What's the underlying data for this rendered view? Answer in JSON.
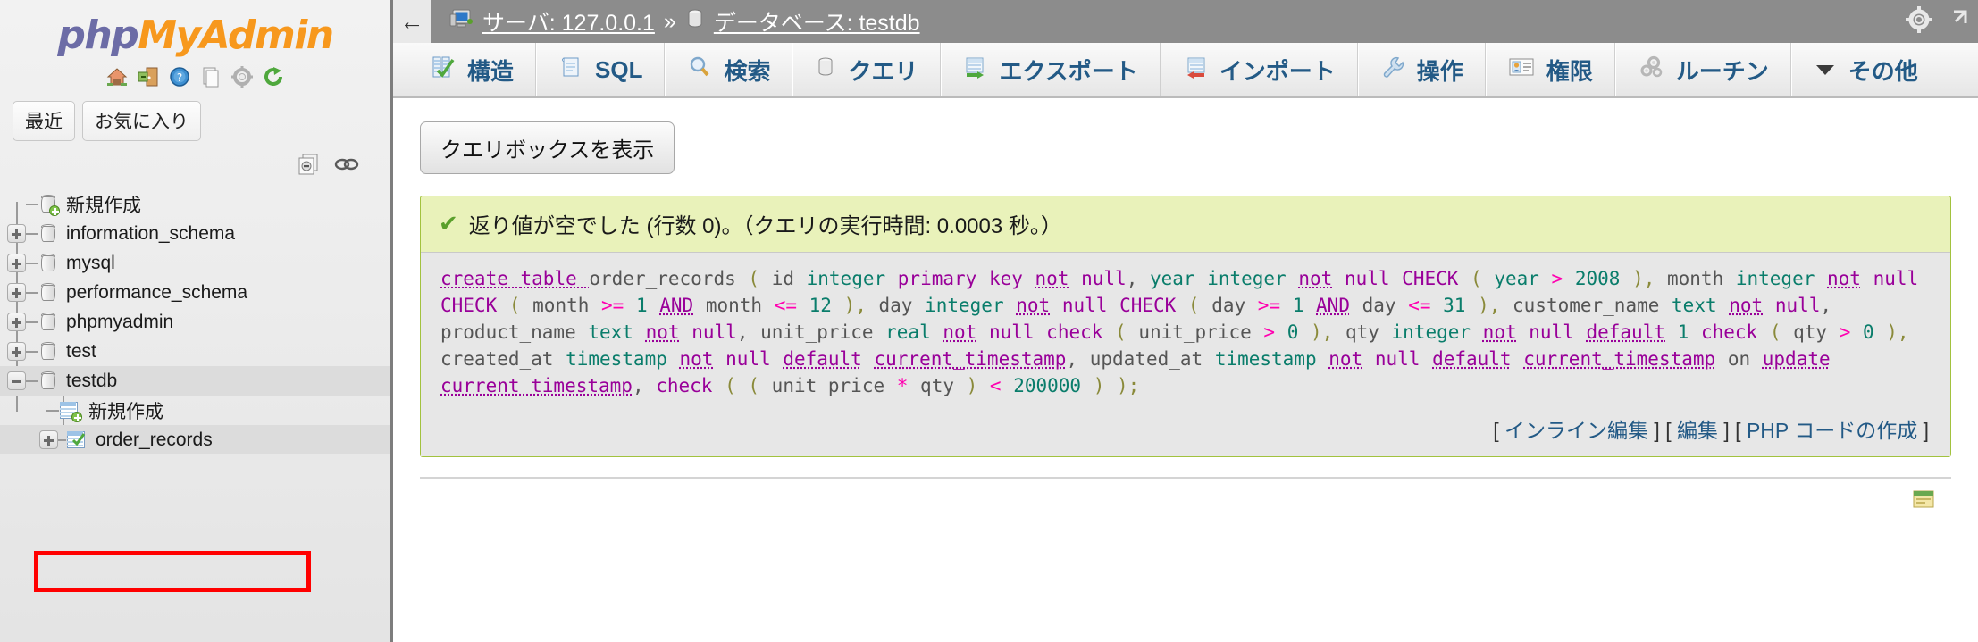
{
  "sidebar": {
    "logo": {
      "part1": "php",
      "part2": "MyAdmin"
    },
    "logo_icons": [
      {
        "name": "home-icon",
        "title": "ホーム"
      },
      {
        "name": "logout-icon",
        "title": "ログアウト"
      },
      {
        "name": "help-icon",
        "title": "ヘルプ"
      },
      {
        "name": "docs-icon",
        "title": "ドキュメント"
      },
      {
        "name": "settings-icon",
        "title": "設定"
      },
      {
        "name": "reload-icon",
        "title": "再読み込み"
      }
    ],
    "quick_tabs": [
      {
        "label": "最近"
      },
      {
        "label": "お気に入り"
      }
    ],
    "tree_controls": [
      {
        "name": "collapse-all-icon"
      },
      {
        "name": "link-with-main-icon"
      }
    ],
    "tree": [
      {
        "label": "新規作成",
        "type": "new-db",
        "expander": "none",
        "selected": false
      },
      {
        "label": "information_schema",
        "type": "db",
        "expander": "plus",
        "selected": false
      },
      {
        "label": "mysql",
        "type": "db",
        "expander": "plus",
        "selected": false
      },
      {
        "label": "performance_schema",
        "type": "db",
        "expander": "plus",
        "selected": false
      },
      {
        "label": "phpmyadmin",
        "type": "db",
        "expander": "plus",
        "selected": false
      },
      {
        "label": "test",
        "type": "db",
        "expander": "plus",
        "selected": false
      },
      {
        "label": "testdb",
        "type": "db",
        "expander": "minus",
        "selected": true
      }
    ],
    "tree_children": [
      {
        "label": "新規作成",
        "type": "new-table",
        "expander": "none"
      },
      {
        "label": "order_records",
        "type": "table",
        "expander": "plus",
        "highlighted": true
      }
    ],
    "highlight_color": "#ff0000"
  },
  "topbar": {
    "back_icon": "←",
    "server_icon": "server-icon",
    "server_label": "サーバ: 127.0.0.1",
    "separator": "»",
    "db_icon": "database-icon",
    "db_label": "データベース: testdb",
    "right_icons": [
      {
        "name": "settings-gear-icon"
      },
      {
        "name": "external-link-icon"
      }
    ]
  },
  "tabs": [
    {
      "label": "構造",
      "icon": "structure-icon",
      "active": false
    },
    {
      "label": "SQL",
      "icon": "sql-icon",
      "active": false
    },
    {
      "label": "検索",
      "icon": "search-icon",
      "active": false
    },
    {
      "label": "クエリ",
      "icon": "query-icon",
      "active": false
    },
    {
      "label": "エクスポート",
      "icon": "export-icon",
      "active": false
    },
    {
      "label": "インポート",
      "icon": "import-icon",
      "active": false
    },
    {
      "label": "操作",
      "icon": "operations-wrench-icon",
      "active": false
    },
    {
      "label": "権限",
      "icon": "privileges-icon",
      "active": false
    },
    {
      "label": "ルーチン",
      "icon": "routines-gears-icon",
      "active": false
    },
    {
      "label": "その他",
      "icon": "chevron-down-icon",
      "active": false
    }
  ],
  "content": {
    "show_query_button": "クエリボックスを表示",
    "result_message": "返り値が空でした (行数 0)。（クエリの実行時間: 0.0003 秒。）",
    "sql_lines": [
      [
        {
          "t": "create ",
          "c": "kwu"
        },
        {
          "t": "table ",
          "c": "kwu"
        },
        {
          "t": "order_records ",
          "c": "idn"
        },
        {
          "t": "( ",
          "c": "pn"
        },
        {
          "t": "id ",
          "c": "idn"
        },
        {
          "t": "integer ",
          "c": "typ"
        },
        {
          "t": "primary ",
          "c": "kw"
        },
        {
          "t": "key ",
          "c": "kw"
        },
        {
          "t": "not",
          "c": "kwu"
        },
        {
          "t": " ",
          "c": "idn"
        },
        {
          "t": "null",
          "c": "kw"
        },
        {
          "t": ", ",
          "c": "idn"
        },
        {
          "t": "year ",
          "c": "typ"
        },
        {
          "t": "integer ",
          "c": "typ"
        },
        {
          "t": "not",
          "c": "kwu"
        },
        {
          "t": " ",
          "c": "idn"
        },
        {
          "t": "null ",
          "c": "kw"
        },
        {
          "t": "CHECK ",
          "c": "kw"
        },
        {
          "t": "( ",
          "c": "pn"
        },
        {
          "t": "year ",
          "c": "typ"
        },
        {
          "t": "> ",
          "c": "op"
        },
        {
          "t": "2008 ",
          "c": "num"
        },
        {
          "t": "), ",
          "c": "pn"
        },
        {
          "t": "month ",
          "c": "idn"
        },
        {
          "t": "integer ",
          "c": "typ"
        },
        {
          "t": "not",
          "c": "kwu"
        },
        {
          "t": " ",
          "c": "idn"
        },
        {
          "t": "null",
          "c": "kw"
        }
      ],
      [
        {
          "t": "CHECK ",
          "c": "kw"
        },
        {
          "t": "( ",
          "c": "pn"
        },
        {
          "t": "month ",
          "c": "idn"
        },
        {
          "t": ">= ",
          "c": "op"
        },
        {
          "t": "1 ",
          "c": "num"
        },
        {
          "t": "AND",
          "c": "kwu"
        },
        {
          "t": " ",
          "c": "idn"
        },
        {
          "t": "month ",
          "c": "idn"
        },
        {
          "t": "<= ",
          "c": "op"
        },
        {
          "t": "12 ",
          "c": "num"
        },
        {
          "t": "), ",
          "c": "pn"
        },
        {
          "t": "day ",
          "c": "idn"
        },
        {
          "t": "integer ",
          "c": "typ"
        },
        {
          "t": "not",
          "c": "kwu"
        },
        {
          "t": " ",
          "c": "idn"
        },
        {
          "t": "null ",
          "c": "kw"
        },
        {
          "t": "CHECK ",
          "c": "kw"
        },
        {
          "t": "( ",
          "c": "pn"
        },
        {
          "t": "day ",
          "c": "idn"
        },
        {
          "t": ">= ",
          "c": "op"
        },
        {
          "t": "1 ",
          "c": "num"
        },
        {
          "t": "AND",
          "c": "kwu"
        },
        {
          "t": " ",
          "c": "idn"
        },
        {
          "t": "day ",
          "c": "idn"
        },
        {
          "t": "<= ",
          "c": "op"
        },
        {
          "t": "31 ",
          "c": "num"
        },
        {
          "t": "), ",
          "c": "pn"
        },
        {
          "t": "customer_name ",
          "c": "idn"
        },
        {
          "t": "text ",
          "c": "typ"
        },
        {
          "t": "not",
          "c": "kwu"
        },
        {
          "t": " ",
          "c": "idn"
        },
        {
          "t": "null",
          "c": "kw"
        },
        {
          "t": ",",
          "c": "idn"
        }
      ],
      [
        {
          "t": "product_name ",
          "c": "idn"
        },
        {
          "t": "text ",
          "c": "typ"
        },
        {
          "t": "not",
          "c": "kwu"
        },
        {
          "t": " ",
          "c": "idn"
        },
        {
          "t": "null",
          "c": "kw"
        },
        {
          "t": ", ",
          "c": "idn"
        },
        {
          "t": "unit_price ",
          "c": "idn"
        },
        {
          "t": "real ",
          "c": "typ"
        },
        {
          "t": "not",
          "c": "kwu"
        },
        {
          "t": " ",
          "c": "idn"
        },
        {
          "t": "null ",
          "c": "kw"
        },
        {
          "t": "check ",
          "c": "kw"
        },
        {
          "t": "( ",
          "c": "pn"
        },
        {
          "t": "unit_price ",
          "c": "idn"
        },
        {
          "t": "> ",
          "c": "op"
        },
        {
          "t": "0 ",
          "c": "num"
        },
        {
          "t": "), ",
          "c": "pn"
        },
        {
          "t": "qty ",
          "c": "idn"
        },
        {
          "t": "integer ",
          "c": "typ"
        },
        {
          "t": "not",
          "c": "kwu"
        },
        {
          "t": " ",
          "c": "idn"
        },
        {
          "t": "null ",
          "c": "kw"
        },
        {
          "t": "default",
          "c": "kwu"
        },
        {
          "t": " ",
          "c": "idn"
        },
        {
          "t": "1 ",
          "c": "num"
        },
        {
          "t": "check ",
          "c": "kw"
        },
        {
          "t": "( ",
          "c": "pn"
        },
        {
          "t": "qty ",
          "c": "idn"
        },
        {
          "t": "> ",
          "c": "op"
        },
        {
          "t": "0 ",
          "c": "num"
        },
        {
          "t": "),",
          "c": "pn"
        }
      ],
      [
        {
          "t": "created_at ",
          "c": "idn"
        },
        {
          "t": "timestamp ",
          "c": "typ"
        },
        {
          "t": "not",
          "c": "kwu"
        },
        {
          "t": " ",
          "c": "idn"
        },
        {
          "t": "null ",
          "c": "kw"
        },
        {
          "t": "default",
          "c": "kwu"
        },
        {
          "t": " ",
          "c": "idn"
        },
        {
          "t": "current_timestamp",
          "c": "kwu"
        },
        {
          "t": ", ",
          "c": "idn"
        },
        {
          "t": "updated_at ",
          "c": "idn"
        },
        {
          "t": "timestamp ",
          "c": "typ"
        },
        {
          "t": "not",
          "c": "kwu"
        },
        {
          "t": " ",
          "c": "idn"
        },
        {
          "t": "null ",
          "c": "kw"
        },
        {
          "t": "default",
          "c": "kwu"
        },
        {
          "t": " ",
          "c": "idn"
        },
        {
          "t": "current_timestamp",
          "c": "kwu"
        },
        {
          "t": " ",
          "c": "idn"
        },
        {
          "t": "on ",
          "c": "idn"
        },
        {
          "t": "update",
          "c": "kwu"
        }
      ],
      [
        {
          "t": "current_timestamp",
          "c": "kwu"
        },
        {
          "t": ", ",
          "c": "idn"
        },
        {
          "t": "check ",
          "c": "kw"
        },
        {
          "t": "( ( ",
          "c": "pn"
        },
        {
          "t": "unit_price ",
          "c": "idn"
        },
        {
          "t": "* ",
          "c": "op"
        },
        {
          "t": "qty ",
          "c": "idn"
        },
        {
          "t": ") ",
          "c": "pn"
        },
        {
          "t": "< ",
          "c": "op"
        },
        {
          "t": "200000 ",
          "c": "num"
        },
        {
          "t": ") );",
          "c": "pn"
        }
      ]
    ],
    "sql_plain": "create table order_records ( id integer primary key not null, year integer not null CHECK ( year > 2008 ), month integer not null CHECK ( month >= 1 AND month <= 12 ), day integer not null CHECK ( day >= 1 AND day <= 31 ), customer_name text not null, product_name text not null, unit_price real not null check ( unit_price > 0 ), qty integer not null default 1 check ( qty > 0 ), created_at timestamp not null default current_timestamp, updated_at timestamp not null default current_timestamp on update current_timestamp, check ( ( unit_price * qty ) < 200000 ) );",
    "footer_links": [
      {
        "bracket_open": "[",
        "label": "インライン編集",
        "bracket_close": "]"
      },
      {
        "bracket_open": "[",
        "label": "編集",
        "bracket_close": "]"
      },
      {
        "bracket_open": "[",
        "label": "PHP コードの作成",
        "bracket_close": "]"
      }
    ]
  },
  "colors": {
    "logo_php": "#6c6ca6",
    "logo_my": "#f7981d",
    "success_bg": "#e9f2ba",
    "success_border": "#a2c23e",
    "topbar_bg": "#8c8c8c",
    "link": "#235a86",
    "highlight": "#ff0000"
  }
}
